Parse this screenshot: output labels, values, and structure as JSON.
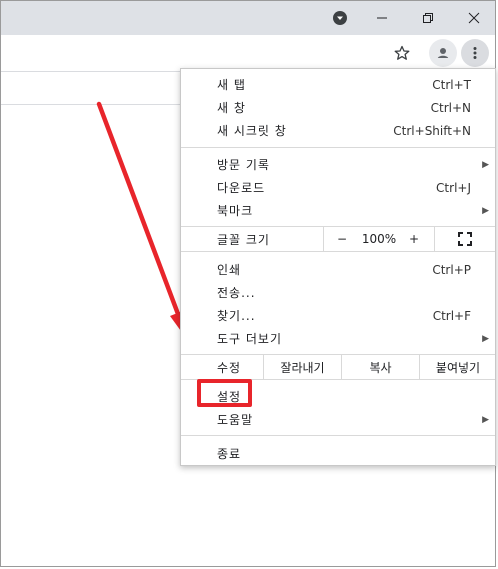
{
  "window": {
    "controls": [
      "profile-dropdown-icon",
      "minimize-icon",
      "restore-icon",
      "close-icon"
    ]
  },
  "toolbar": {
    "icons": [
      "bookmark-star-icon",
      "profile-icon",
      "more-menu-icon"
    ]
  },
  "menu": {
    "new_tab": {
      "label": "새 탭",
      "shortcut": "Ctrl+T"
    },
    "new_window": {
      "label": "새 창",
      "shortcut": "Ctrl+N"
    },
    "new_incognito": {
      "label": "새 시크릿 창",
      "shortcut": "Ctrl+Shift+N"
    },
    "history": {
      "label": "방문 기록"
    },
    "downloads": {
      "label": "다운로드",
      "shortcut": "Ctrl+J"
    },
    "bookmarks": {
      "label": "북마크"
    },
    "zoom": {
      "label": "글꼴 크기",
      "minus": "−",
      "value": "100%",
      "plus": "+"
    },
    "print": {
      "label": "인쇄",
      "shortcut": "Ctrl+P"
    },
    "cast": {
      "label": "전송..."
    },
    "find": {
      "label": "찾기...",
      "shortcut": "Ctrl+F"
    },
    "more_tools": {
      "label": "도구 더보기"
    },
    "edit": {
      "label": "수정",
      "cut": "잘라내기",
      "copy": "복사",
      "paste": "붙여넣기"
    },
    "settings": {
      "label": "설정"
    },
    "help": {
      "label": "도움말"
    },
    "exit": {
      "label": "종료"
    }
  },
  "annotation": {
    "arrow_color": "#e8252b",
    "highlight_color": "#e8252b"
  }
}
